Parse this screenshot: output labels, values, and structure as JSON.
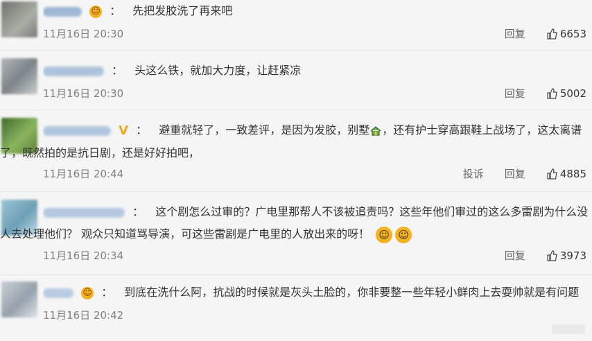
{
  "colors": {
    "background": "#f5f5f5",
    "text": "#333333",
    "meta": "#808080",
    "vip": "#f5a623"
  },
  "comments": [
    {
      "text": "先把发胶洗了再来吧",
      "time": "11月16日 20:30",
      "reply": "回复",
      "likes": "6653",
      "avatar_color": "#8a8f86",
      "badge": "emoji"
    },
    {
      "text": "头这么铁，就加大力度，让赶紧凉",
      "time": "11月16日 20:30",
      "reply": "回复",
      "likes": "5002",
      "avatar_color": "#9aa0a4",
      "badge": "none"
    },
    {
      "text_line1_a": "避重就轻了，一致差评，是因为发胶，别墅",
      "text_line1_b": "，还有护士穿高跟鞋上战场了，这太离谱",
      "text_line2": "了，既然拍的是抗日剧，还是好好拍吧，",
      "time": "11月16日 20:44",
      "report": "投诉",
      "reply": "回复",
      "likes": "4885",
      "avatar_color": "#5f7f45",
      "badge": "vip"
    },
    {
      "text_line1": "这个剧怎么过审的？广电里那帮人不该被追责吗？这些年他们审过的这么多雷剧为什么没",
      "text_line2": "人去处理他们？ 观众只知道骂导演，可这些雷剧是广电里的人放出来的呀！",
      "time": "11月16日 20:34",
      "reply": "回复",
      "likes": "3973",
      "avatar_color": "#8fb6c8",
      "badge": "none"
    },
    {
      "text": "到底在洗什么阿，抗战的时候就是灰头土脸的，你非要整一些年轻小鲜肉上去耍帅就是有问题",
      "time": "11月16日 20:42",
      "avatar_color": "#b8c0c8",
      "badge": "emoji"
    }
  ],
  "separator": "：",
  "icons": {
    "like": "thumb-up-icon",
    "emoji": "grin-emoji-icon",
    "vip": "vip-badge-icon",
    "house": "house-icon"
  }
}
